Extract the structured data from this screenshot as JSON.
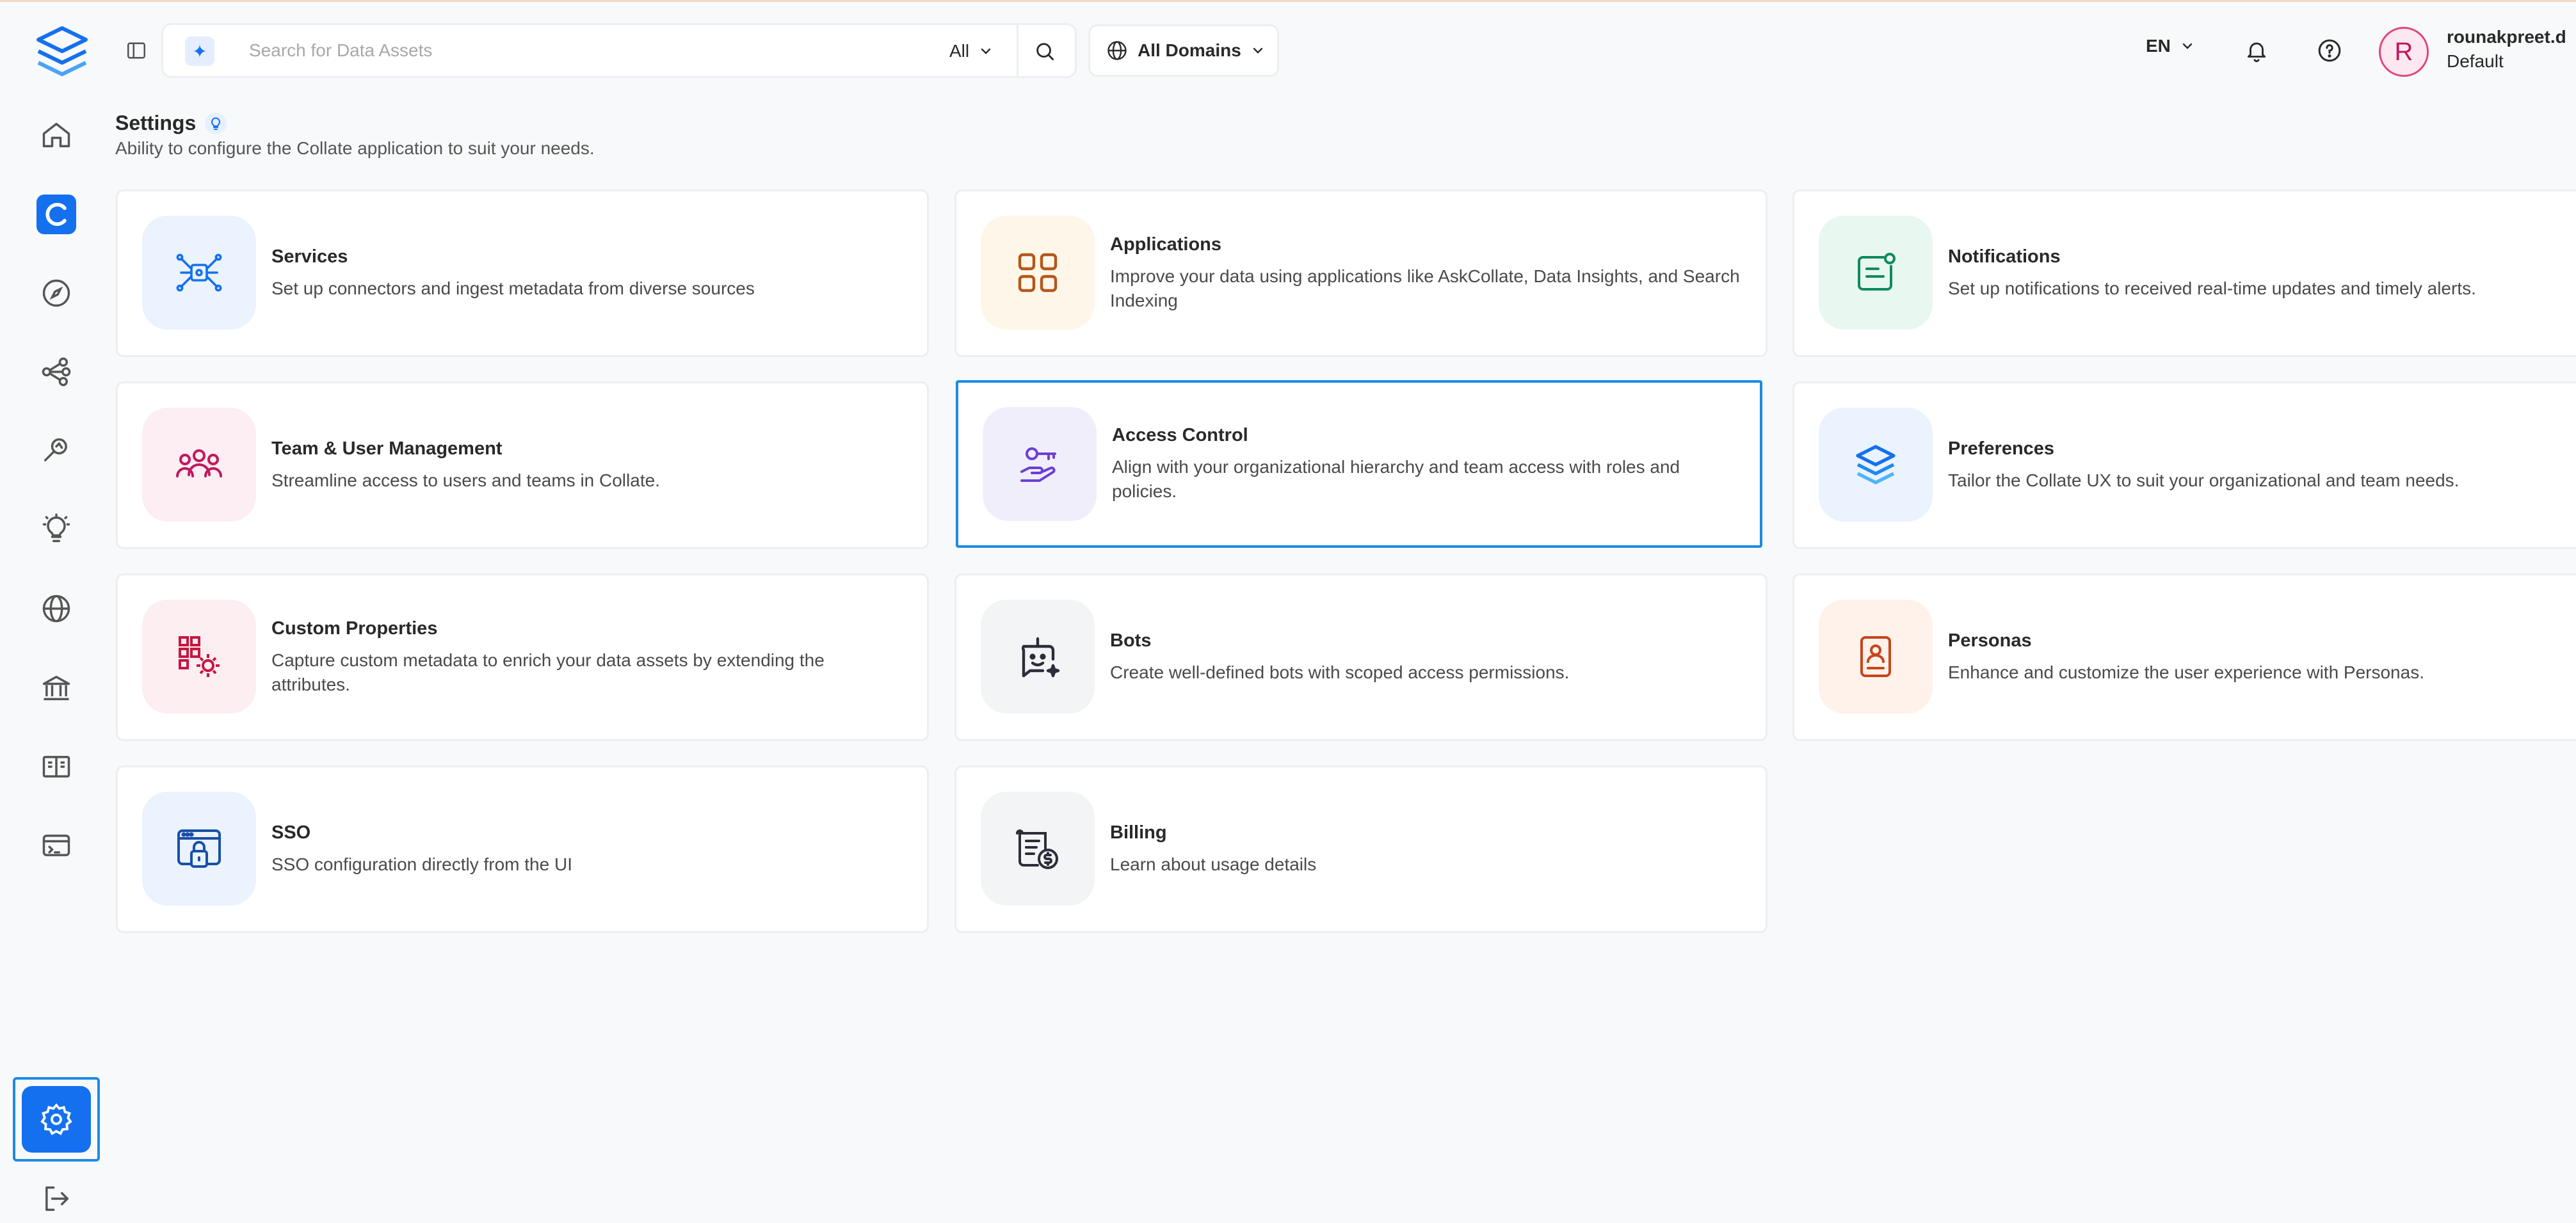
{
  "header": {
    "search_placeholder": "Search for Data Assets",
    "search_filter": "All",
    "domain_selector": "All Domains",
    "language": "EN",
    "user": {
      "avatar_initial": "R",
      "name": "rounakpreet.d",
      "role": "Default"
    }
  },
  "page": {
    "title": "Settings",
    "subtitle": "Ability to configure the Collate application to suit your needs."
  },
  "cards": [
    {
      "title": "Services",
      "description": "Set up connectors and ingest metadata from diverse sources",
      "icon": "services-icon"
    },
    {
      "title": "Applications",
      "description": "Improve your data using applications like AskCollate, Data Insights, and Search Indexing",
      "icon": "applications-icon"
    },
    {
      "title": "Notifications",
      "description": "Set up notifications to received real-time updates and timely alerts.",
      "icon": "notifications-icon"
    },
    {
      "title": "Team & User Management",
      "description": "Streamline access to users and teams in Collate.",
      "icon": "team-icon"
    },
    {
      "title": "Access Control",
      "description": "Align with your organizational hierarchy and team access with roles and policies.",
      "icon": "access-control-icon"
    },
    {
      "title": "Preferences",
      "description": "Tailor the Collate UX to suit your organizational and team needs.",
      "icon": "preferences-icon"
    },
    {
      "title": "Custom Properties",
      "description": "Capture custom metadata to enrich your data assets by extending the attributes.",
      "icon": "custom-properties-icon"
    },
    {
      "title": "Bots",
      "description": "Create well-defined bots with scoped access permissions.",
      "icon": "bots-icon"
    },
    {
      "title": "Personas",
      "description": "Enhance and customize the user experience with Personas.",
      "icon": "personas-icon"
    },
    {
      "title": "SSO",
      "description": "SSO configuration directly from the UI",
      "icon": "sso-icon"
    },
    {
      "title": "Billing",
      "description": "Learn about usage details",
      "icon": "billing-icon"
    }
  ],
  "colors": {
    "accent": "#1470ef",
    "selected_border": "#1c8be3",
    "services_bg": "#eaf3fe",
    "applications_bg": "#fef7e9",
    "notifications_bg": "#e8f8f1",
    "team_bg": "#fdeef4",
    "access_control_bg": "#f1eefc",
    "preferences_bg": "#eaf3fe",
    "custom_properties_bg": "#fdeef2",
    "bots_bg": "#f3f4f6",
    "personas_bg": "#fef2ea",
    "sso_bg": "#eaf3fe",
    "billing_bg": "#f3f4f6"
  },
  "selected_card": "Access Control"
}
